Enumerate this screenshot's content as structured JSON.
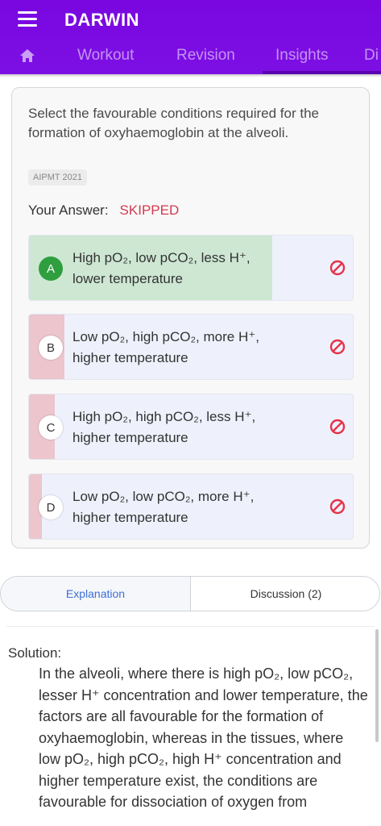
{
  "app": {
    "title": "DARWIN"
  },
  "tabs": [
    {
      "label": "Workout"
    },
    {
      "label": "Revision"
    },
    {
      "label": "Insights"
    },
    {
      "label": "Di"
    }
  ],
  "question": {
    "text": "Select the favourable conditions required for the formation of oxyhaemoglobin at the alveoli.",
    "tag": "AIPMT 2021",
    "your_answer_label": "Your Answer:",
    "your_answer_value": "SKIPPED"
  },
  "options": [
    {
      "letter": "A",
      "line1": "High pO₂, low pCO₂, less H⁺,",
      "line2": "lower temperature",
      "response_fraction": 0.75,
      "correct": true
    },
    {
      "letter": "B",
      "line1": "Low pO₂, high pCO₂, more H⁺,",
      "line2": "higher temperature",
      "response_fraction": 0.11,
      "correct": false
    },
    {
      "letter": "C",
      "line1": "High pO₂, high pCO₂, less H⁺,",
      "line2": "higher temperature",
      "response_fraction": 0.08,
      "correct": false
    },
    {
      "letter": "D",
      "line1": "Low pO₂, low pCO₂, more H⁺,",
      "line2": "higher temperature",
      "response_fraction": 0.04,
      "correct": false
    }
  ],
  "toggle": {
    "explanation": "Explanation",
    "discussion": "Discussion (2)"
  },
  "solution": {
    "label": "Solution:",
    "text": "In the alveoli, where there is high pO₂, low pCO₂, lesser H⁺ concentration and lower temperature, the factors are all favourable for the formation of oxyhaemoglobin, whereas in the tissues, where low pO₂, high pCO₂, high H⁺ concentration and higher temperature exist, the conditions are favourable for dissociation of oxygen from"
  },
  "colors": {
    "header": "#7c0ae6",
    "correct_fill": "#cde7d3",
    "wrong_fill": "#ecc5cd",
    "skipped": "#d33a4f",
    "ban_icon": "#e5334b"
  }
}
